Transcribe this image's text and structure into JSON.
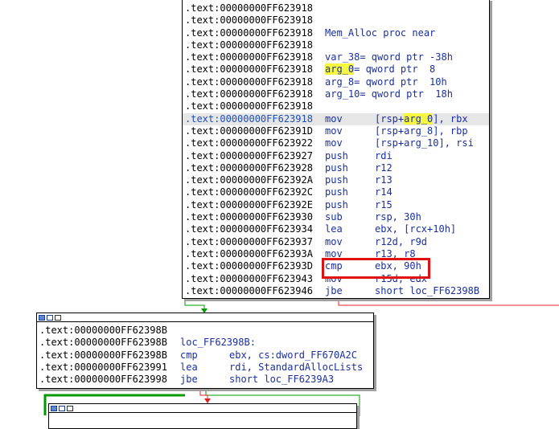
{
  "colors": {
    "green_edge": "#009900",
    "red_edge": "#e02020",
    "instruction": "#1a2fa0",
    "highlight": "#f7f740",
    "red_box": "#e01010"
  },
  "block1": {
    "lines": [
      {
        "addr": ".text:00000000FF623918",
        "mn": "",
        "op": ""
      },
      {
        "addr": ".text:00000000FF623918",
        "mn": "",
        "op": ""
      },
      {
        "addr": ".text:00000000FF623918",
        "label": "Mem_Alloc proc near"
      },
      {
        "addr": ".text:00000000FF623918",
        "mn": "",
        "op": ""
      },
      {
        "addr": ".text:00000000FF623918",
        "label": "var_38= qword ptr -38h"
      },
      {
        "addr": ".text:00000000FF623918",
        "label_hl": "arg_0",
        "label_rest": "= qword ptr  8"
      },
      {
        "addr": ".text:00000000FF623918",
        "label": "arg_8= qword ptr  10h"
      },
      {
        "addr": ".text:00000000FF623918",
        "label": "arg_10= qword ptr  18h"
      },
      {
        "addr": ".text:00000000FF623918",
        "mn": "",
        "op": ""
      },
      {
        "addr": ".text:00000000FF623918",
        "mn": "mov",
        "op_pre": "[rsp+",
        "op_hl": "arg_0",
        "op_post": "], rbx",
        "selected": true
      },
      {
        "addr": ".text:00000000FF62391D",
        "mn": "mov",
        "op": "[rsp+arg_8], rbp"
      },
      {
        "addr": ".text:00000000FF623922",
        "mn": "mov",
        "op": "[rsp+arg_10], rsi"
      },
      {
        "addr": ".text:00000000FF623927",
        "mn": "push",
        "op": "rdi"
      },
      {
        "addr": ".text:00000000FF623928",
        "mn": "push",
        "op": "r12"
      },
      {
        "addr": ".text:00000000FF62392A",
        "mn": "push",
        "op": "r13"
      },
      {
        "addr": ".text:00000000FF62392C",
        "mn": "push",
        "op": "r14"
      },
      {
        "addr": ".text:00000000FF62392E",
        "mn": "push",
        "op": "r15"
      },
      {
        "addr": ".text:00000000FF623930",
        "mn": "sub",
        "op": "rsp, 30h"
      },
      {
        "addr": ".text:00000000FF623934",
        "mn": "lea",
        "op": "ebx, [rcx+10h]"
      },
      {
        "addr": ".text:00000000FF623937",
        "mn": "mov",
        "op": "r12d, r9d"
      },
      {
        "addr": ".text:00000000FF62393A",
        "mn": "mov",
        "op": "r13, r8"
      },
      {
        "addr": ".text:00000000FF62393D",
        "mn": "cmp",
        "op": "ebx, 90h"
      },
      {
        "addr": ".text:00000000FF623943",
        "mn": "mov",
        "op": "r15d, edx"
      },
      {
        "addr": ".text:00000000FF623946",
        "mn": "jbe",
        "op": "short loc_FF62398B"
      }
    ]
  },
  "block2": {
    "lines": [
      {
        "addr": ".text:00000000FF62398B",
        "mn": "",
        "op": ""
      },
      {
        "addr": ".text:00000000FF62398B",
        "label": "loc_FF62398B:"
      },
      {
        "addr": ".text:00000000FF62398B",
        "mn": "cmp",
        "op": "ebx, cs:dword_FF670A2C"
      },
      {
        "addr": ".text:00000000FF623991",
        "mn": "lea",
        "op": "rdi, StandardAllocLists"
      },
      {
        "addr": ".text:00000000FF623998",
        "mn": "jbe",
        "op": "short loc_FF6239A3"
      }
    ]
  }
}
